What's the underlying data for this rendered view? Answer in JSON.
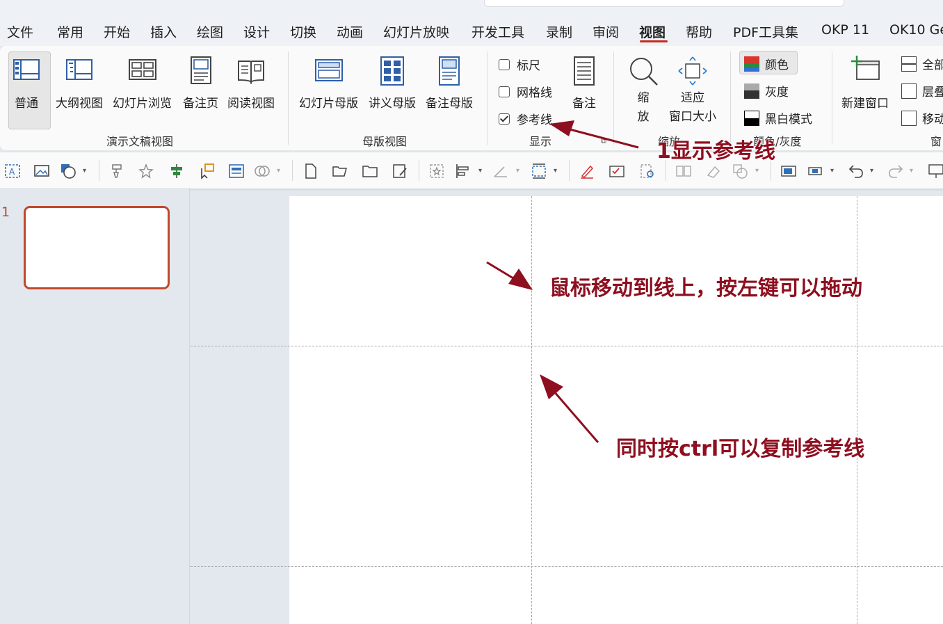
{
  "menu": {
    "tabs": [
      "文件",
      "常用",
      "开始",
      "插入",
      "绘图",
      "设计",
      "切换",
      "动画",
      "幻灯片放映",
      "开发工具",
      "录制",
      "审阅",
      "视图",
      "帮助",
      "PDF工具集",
      "OKP 11",
      "OK10 Ge"
    ],
    "active": "视图"
  },
  "ribbon": {
    "presentation_views": {
      "normal": "普通",
      "outline": "大纲视图",
      "sorter": "幻灯片浏览",
      "notes_page": "备注页",
      "reading": "阅读视图",
      "group": "演示文稿视图"
    },
    "master_views": {
      "slide_master": "幻灯片母版",
      "handout_master": "讲义母版",
      "notes_master": "备注母版",
      "group": "母版视图"
    },
    "show": {
      "ruler": "标尺",
      "ruler_checked": false,
      "gridlines": "网格线",
      "gridlines_checked": false,
      "guides": "参考线",
      "guides_checked": true,
      "notes": "备注",
      "group": "显示"
    },
    "zoom": {
      "zoom_line1": "缩",
      "zoom_line2": "放",
      "fit_line1": "适应",
      "fit_line2": "窗口大小",
      "group": "缩放"
    },
    "color": {
      "color": "颜色",
      "grayscale": "灰度",
      "bw": "黑白模式",
      "group": "颜色/灰度"
    },
    "window": {
      "new_window": "新建窗口",
      "arrange_all": "全部",
      "cascade": "层叠",
      "move_split": "移动",
      "group": "窗"
    }
  },
  "slides": {
    "number": "1"
  },
  "annotations": {
    "a1": "1显示参考线",
    "a2": "鼠标移动到线上，按左键可以拖动",
    "a3": "同时按ctrl可以复制参考线"
  },
  "colors": {
    "accent": "#c42b1c",
    "annotation": "#8e0f1f",
    "thumb_border": "#c0482b"
  }
}
